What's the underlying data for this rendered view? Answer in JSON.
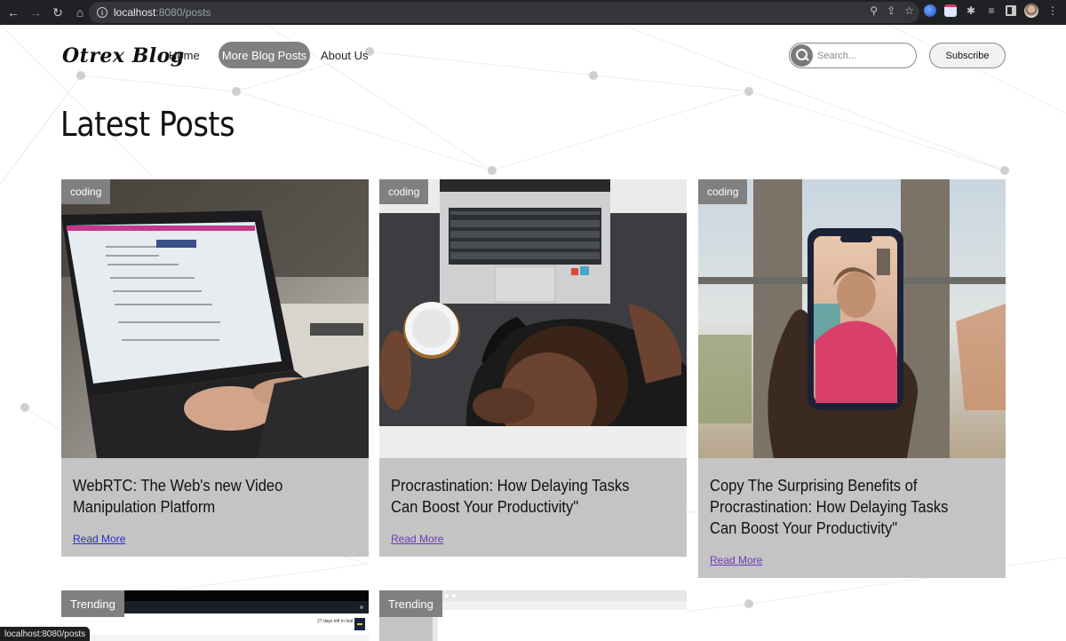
{
  "browser": {
    "url_host": "localhost",
    "url_rest": ":8080/posts",
    "status_url": "localhost:8080/posts"
  },
  "site": {
    "logo": "Otrex Blog",
    "nav": [
      {
        "label": "Home"
      },
      {
        "label": "More Blog Posts",
        "active": true
      },
      {
        "label": "About Us"
      }
    ],
    "search_placeholder": "Search...",
    "subscribe_label": "Subscribe"
  },
  "main": {
    "title": "Latest Posts",
    "posts": [
      {
        "category": "coding",
        "title": "WebRTC: The Web's new Video Manipulation Platform",
        "link": "Read More",
        "image": "laptop-typing-photo"
      },
      {
        "category": "coding",
        "title": "Procrastination: How Delaying Tasks Can Boost Your Productivity\"",
        "link": "Read More",
        "image": "man-sleeping-on-desk-photo"
      },
      {
        "category": "coding",
        "title": "Copy The Surprising Benefits of Procrastination: How Delaying Tasks Can Boost Your Productivity\"",
        "link": "Read More",
        "image": "phone-video-call-photo"
      },
      {
        "category": "Trending",
        "image": "dashboard-screenshot",
        "snippet": "27 days left in trial"
      },
      {
        "category": "Trending",
        "image": "browser-window-screenshot"
      }
    ]
  },
  "colors": {
    "tag_bg": "#808080",
    "card_bg": "#c4c4c4",
    "link": "#2a2ad0",
    "visited_link": "#6c3bb5"
  }
}
